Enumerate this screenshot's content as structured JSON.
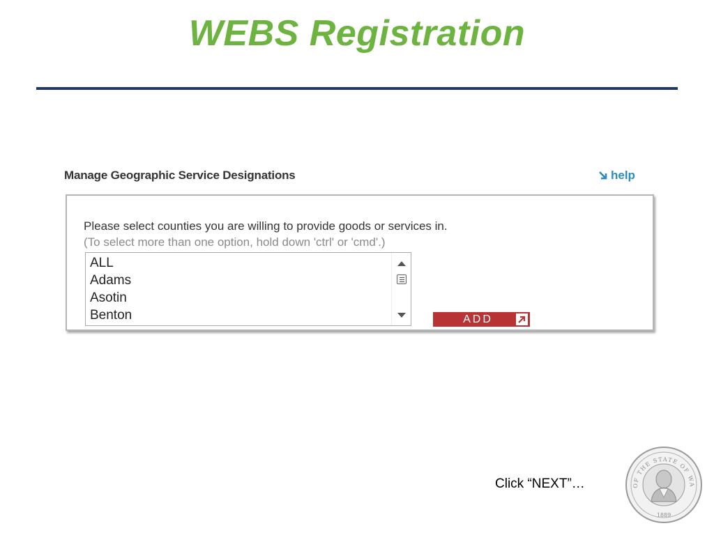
{
  "slide": {
    "title": "WEBS Registration",
    "title_color": "#6cb33f",
    "rule_color": "#1b3a6b",
    "footer_note": "Click “NEXT”…"
  },
  "panel": {
    "header": "Manage Geographic Service Designations",
    "help_label": "help",
    "help_icon": "arrow-down-right-icon",
    "instruction": "Please select counties you are willing to provide goods or services in.",
    "hint": "(To select more than one option, hold down 'ctrl' or 'cmd'.)",
    "counties": [
      "ALL",
      "Adams",
      "Asotin",
      "Benton"
    ],
    "add_label": "ADD",
    "add_icon": "arrow-up-right-icon",
    "accent_color": "#b83333",
    "link_color": "#2a8bc4"
  },
  "seal": {
    "icon": "washington-state-seal",
    "text": "THE SEAL OF THE STATE OF WASHINGTON 1889"
  }
}
